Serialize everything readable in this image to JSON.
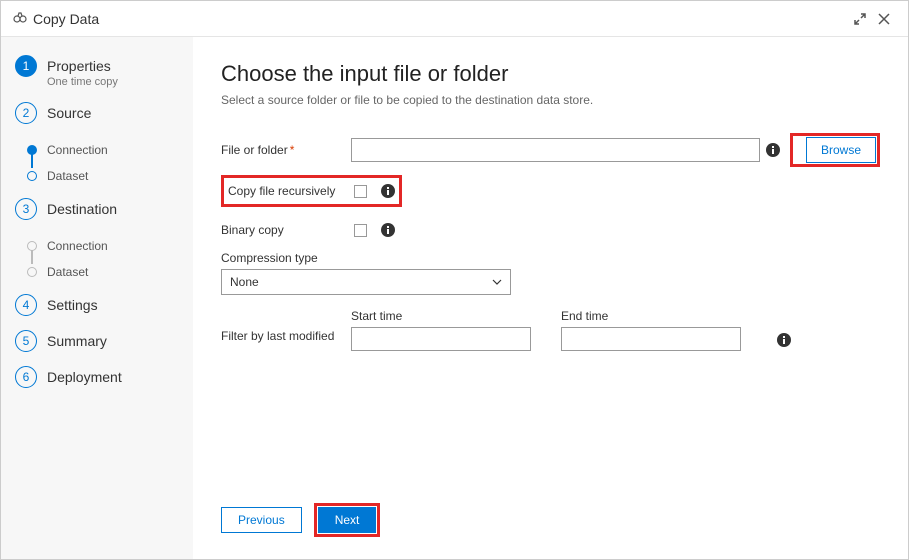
{
  "window": {
    "title": "Copy Data"
  },
  "sidebar": {
    "steps": [
      {
        "num": "1",
        "label": "Properties",
        "sub": "One time copy"
      },
      {
        "num": "2",
        "label": "Source",
        "children": [
          "Connection",
          "Dataset"
        ]
      },
      {
        "num": "3",
        "label": "Destination",
        "children": [
          "Connection",
          "Dataset"
        ]
      },
      {
        "num": "4",
        "label": "Settings"
      },
      {
        "num": "5",
        "label": "Summary"
      },
      {
        "num": "6",
        "label": "Deployment"
      }
    ]
  },
  "main": {
    "heading": "Choose the input file or folder",
    "subheading": "Select a source folder or file to be copied to the destination data store.",
    "file_label": "File or folder",
    "file_value": "",
    "browse_label": "Browse",
    "recursive_label": "Copy file recursively",
    "binary_label": "Binary copy",
    "compression_label": "Compression type",
    "compression_value": "None",
    "filter_label": "Filter by last modified",
    "start_label": "Start time",
    "start_value": "",
    "end_label": "End time",
    "end_value": "",
    "prev_label": "Previous",
    "next_label": "Next"
  }
}
